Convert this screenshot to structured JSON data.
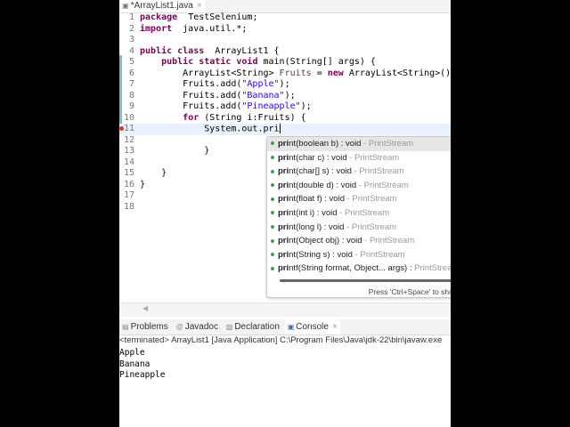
{
  "editor": {
    "tab_title": "*ArrayList1.java",
    "close": "×"
  },
  "code": [
    {
      "n": "1",
      "t": [
        [
          "kw",
          "package"
        ],
        [
          "",
          "  TestSelenium;"
        ]
      ]
    },
    {
      "n": "2",
      "t": [
        [
          "kw",
          "import"
        ],
        [
          "",
          "  java.util.*;"
        ]
      ]
    },
    {
      "n": "3",
      "t": []
    },
    {
      "n": "4",
      "t": [
        [
          "kw",
          "public class"
        ],
        [
          "",
          "  ArrayList1 {"
        ]
      ]
    },
    {
      "n": "5",
      "t": [
        [
          "",
          "    "
        ],
        [
          "kw",
          "public static void"
        ],
        [
          "",
          " main(String[] args) {"
        ]
      ]
    },
    {
      "n": "6",
      "t": [
        [
          "",
          "        ArrayList<String> "
        ],
        [
          "var",
          "Fruits"
        ],
        [
          "",
          " = "
        ],
        [
          "kw",
          "new"
        ],
        [
          "",
          " ArrayList<String>();"
        ]
      ]
    },
    {
      "n": "7",
      "t": [
        [
          "",
          "        Fruits.add("
        ],
        [
          "str",
          "\"Apple\""
        ],
        [
          "",
          ");"
        ]
      ]
    },
    {
      "n": "8",
      "t": [
        [
          "",
          "        Fruits.add("
        ],
        [
          "str",
          "\"Banana\""
        ],
        [
          "",
          ");"
        ]
      ]
    },
    {
      "n": "9",
      "t": [
        [
          "",
          "        Fruits.add("
        ],
        [
          "str",
          "\"Pineapple\""
        ],
        [
          "",
          ");"
        ]
      ]
    },
    {
      "n": "10",
      "t": [
        [
          "",
          "        "
        ],
        [
          "kw",
          "for"
        ],
        [
          "",
          " (String i:Fruits) {"
        ]
      ]
    },
    {
      "n": "11",
      "t": [
        [
          "",
          "            System.out.pri"
        ]
      ],
      "current": true,
      "error": true
    },
    {
      "n": "12",
      "t": []
    },
    {
      "n": "13",
      "t": [
        [
          "",
          "            }"
        ]
      ]
    },
    {
      "n": "14",
      "t": []
    },
    {
      "n": "15",
      "t": [
        [
          "",
          "    }"
        ]
      ]
    },
    {
      "n": "16",
      "t": [
        [
          "",
          "}"
        ]
      ]
    },
    {
      "n": "17",
      "t": []
    },
    {
      "n": "18",
      "t": []
    }
  ],
  "autocomplete": {
    "items": [
      {
        "bold": "pri",
        "rest": "nt(boolean b) : void",
        "src": " - PrintStream"
      },
      {
        "bold": "pri",
        "rest": "nt(char c) : void",
        "src": " - PrintStream"
      },
      {
        "bold": "pri",
        "rest": "nt(char[] s) : void",
        "src": " - PrintStream"
      },
      {
        "bold": "pri",
        "rest": "nt(double d) : void",
        "src": " - PrintStream"
      },
      {
        "bold": "pri",
        "rest": "nt(float f) : void",
        "src": " - PrintStream"
      },
      {
        "bold": "pri",
        "rest": "nt(int i) : void",
        "src": " - PrintStream"
      },
      {
        "bold": "pri",
        "rest": "nt(long l) : void",
        "src": " - PrintStream"
      },
      {
        "bold": "pri",
        "rest": "nt(Object obj) : void",
        "src": " - PrintStream"
      },
      {
        "bold": "pri",
        "rest": "nt(String s) : void",
        "src": " - PrintStream"
      },
      {
        "bold": "pri",
        "rest": "ntf(String format, Object... args) :",
        "src": " PrintStream"
      }
    ],
    "hint": "Press 'Ctrl+Space' to show"
  },
  "views": {
    "tabs": [
      "Problems",
      "Javadoc",
      "Declaration",
      "Console"
    ],
    "active": 3,
    "close": "×"
  },
  "console": {
    "status": "<terminated> ArrayList1 [Java Application] C:\\Program Files\\Java\\jdk-22\\bin\\javaw.exe",
    "output": [
      "Apple",
      "Banana",
      "Pineapple"
    ]
  }
}
